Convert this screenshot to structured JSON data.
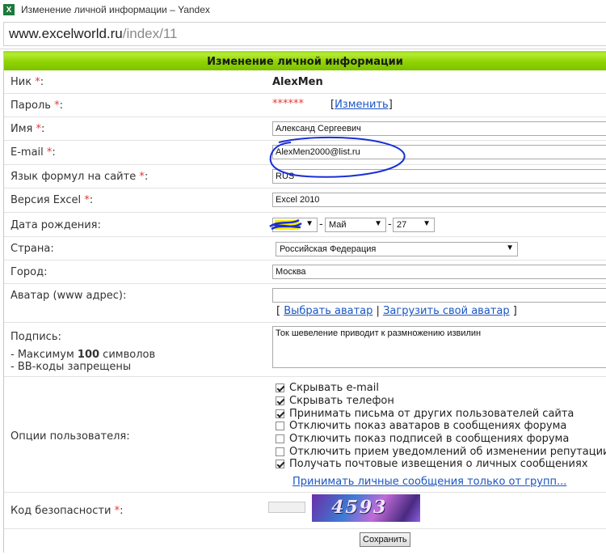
{
  "window": {
    "title": "Изменение личной информации – Yandex",
    "app_icon_glyph": "X"
  },
  "address_bar": {
    "host": "www.excelworld.ru",
    "path": "/index/11"
  },
  "form": {
    "header": "Изменение личной информации",
    "required_mark": "*",
    "nick": {
      "label": "Ник",
      "colon": ":",
      "value": "AlexMen"
    },
    "password": {
      "label": "Пароль",
      "colon": ":",
      "masked": "******",
      "change_open": "[",
      "change_link": "Изменить",
      "change_close": "]"
    },
    "name": {
      "label": "Имя",
      "colon": ":",
      "value": "Александ Сергеевич"
    },
    "email": {
      "label": "E-mail",
      "colon": ":",
      "value": "AlexMen2000@list.ru"
    },
    "formula_lang": {
      "label": "Язык формул на сайте",
      "colon": ":",
      "value": "RUS"
    },
    "excel_version": {
      "label": "Версия Excel",
      "colon": ":",
      "value": "Excel 2010"
    },
    "birth_date": {
      "label": "Дата рождения:",
      "sep": "-",
      "month": "Май",
      "day": "27"
    },
    "country": {
      "label": "Страна:",
      "value": "Российская Федерация"
    },
    "city": {
      "label": "Город:",
      "value": "Москва"
    },
    "avatar": {
      "label": "Аватар (www адрес):",
      "value": "",
      "open": "[",
      "choose_link": "Выбрать аватар",
      "divider": "|",
      "upload_link": "Загрузить свой аватар",
      "close": "]"
    },
    "signature": {
      "label": "Подпись:",
      "hint1_prefix": "- Максимум ",
      "hint1_number": "100",
      "hint1_suffix": " символов",
      "hint2": "- BB-коды запрещены",
      "value": "Ток шевеление приводит к размножению извилин"
    },
    "options": {
      "label": "Опции пользователя:",
      "items": [
        {
          "label": "Скрывать e-mail",
          "checked": true
        },
        {
          "label": "Скрывать телефон",
          "checked": true
        },
        {
          "label": "Принимать письма от других пользователей сайта",
          "checked": true
        },
        {
          "label": "Отключить показ аватаров в сообщениях форума",
          "checked": false
        },
        {
          "label": "Отключить показ подписей в сообщениях форума",
          "checked": false
        },
        {
          "label": "Отключить прием уведомлений об изменении репутации",
          "checked": false
        },
        {
          "label": "Получать почтовые извещения о личных сообщениях",
          "checked": true
        }
      ],
      "groups_link": "Принимать личные сообщения только от групп..."
    },
    "captcha": {
      "label": "Код безопасности",
      "colon": ":",
      "image_text": "4593"
    },
    "save_button": "Сохранить"
  },
  "colors": {
    "header_green": "#8fd400",
    "required_red": "#e53935",
    "link_blue": "#1a55c4",
    "scribble_blue": "#1a2fd6",
    "highlight_yellow": "#ffee00"
  }
}
